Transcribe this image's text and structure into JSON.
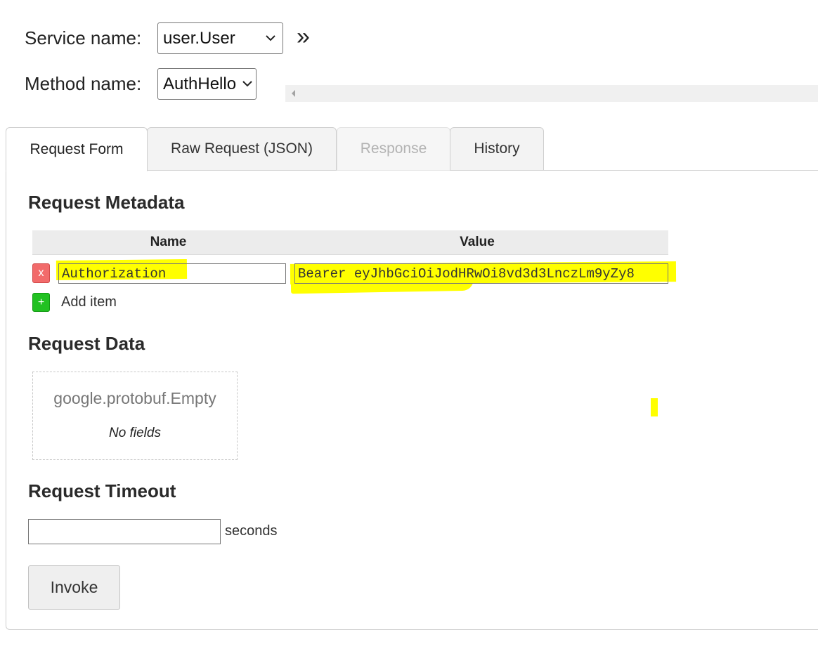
{
  "service": {
    "label": "Service name:",
    "selected": "user.User"
  },
  "method": {
    "label": "Method name:",
    "selected": "AuthHello"
  },
  "expand_glyph": "»",
  "tabs": [
    {
      "label": "Request Form",
      "state": "active"
    },
    {
      "label": "Raw Request (JSON)",
      "state": "normal"
    },
    {
      "label": "Response",
      "state": "disabled"
    },
    {
      "label": "History",
      "state": "normal"
    }
  ],
  "metadata": {
    "heading": "Request Metadata",
    "col_name": "Name",
    "col_value": "Value",
    "rows": [
      {
        "remove_label": "x",
        "name": "Authorization",
        "value": "Bearer eyJhbGciOiJodHRwOi8vd3d3LnczLm9yZy8"
      }
    ],
    "add_icon": "+",
    "add_label": "Add item"
  },
  "request_data": {
    "heading": "Request Data",
    "type_name": "google.protobuf.Empty",
    "empty_text": "No fields"
  },
  "timeout": {
    "heading": "Request Timeout",
    "value": "",
    "unit": "seconds"
  },
  "invoke_label": "Invoke",
  "colors": {
    "highlight": "#ffff00",
    "remove_button": "#f26b6b",
    "add_button": "#21c121"
  }
}
